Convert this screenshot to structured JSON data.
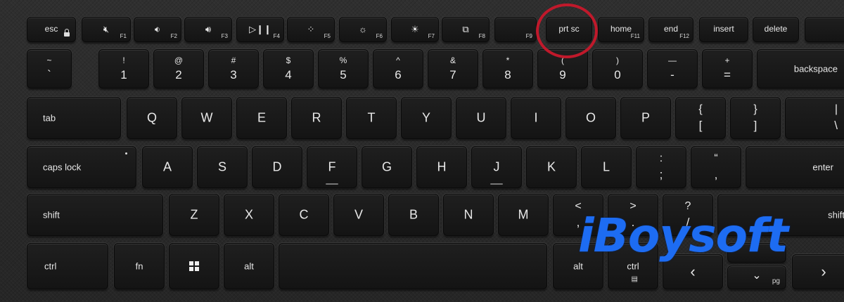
{
  "watermark": {
    "text": "iBoysoft",
    "color": "#1d6cf2"
  },
  "highlight": {
    "color": "#c0192b",
    "target": "prt sc"
  },
  "rows": {
    "function": [
      {
        "id": "esc",
        "label": "esc",
        "fn": ""
      },
      {
        "id": "f1",
        "icon": "mute-icon",
        "glyph": "🔇︎",
        "fn": "F1"
      },
      {
        "id": "f2",
        "icon": "volume-down-icon",
        "glyph": "🔉︎",
        "fn": "F2"
      },
      {
        "id": "f3",
        "icon": "volume-up-icon",
        "glyph": "🔊︎",
        "fn": "F3"
      },
      {
        "id": "f4",
        "icon": "play-pause-icon",
        "glyph": "▷❙❙",
        "fn": "F4"
      },
      {
        "id": "f5",
        "icon": "keyboard-backlight-icon",
        "glyph": "⁘",
        "fn": "F5"
      },
      {
        "id": "f6",
        "icon": "brightness-down-icon",
        "glyph": "☼",
        "fn": "F6"
      },
      {
        "id": "f7",
        "icon": "brightness-up-icon",
        "glyph": "☀",
        "fn": "F7"
      },
      {
        "id": "f8",
        "icon": "display-switch-icon",
        "glyph": "⧉",
        "fn": "F8"
      },
      {
        "id": "f9",
        "label": "",
        "fn": "F9"
      },
      {
        "id": "prtsc",
        "label": "prt sc",
        "fn": ""
      },
      {
        "id": "home",
        "label": "home",
        "fn": "F11"
      },
      {
        "id": "end",
        "label": "end",
        "fn": "F12"
      },
      {
        "id": "insert",
        "label": "insert",
        "fn": ""
      },
      {
        "id": "delete",
        "label": "delete",
        "fn": ""
      }
    ],
    "number": [
      {
        "top": "~",
        "bottom": "`"
      },
      {
        "top": "!",
        "bottom": "1"
      },
      {
        "top": "@",
        "bottom": "2"
      },
      {
        "top": "#",
        "bottom": "3"
      },
      {
        "top": "$",
        "bottom": "4"
      },
      {
        "top": "%",
        "bottom": "5"
      },
      {
        "top": "^",
        "bottom": "6"
      },
      {
        "top": "&",
        "bottom": "7"
      },
      {
        "top": "*",
        "bottom": "8"
      },
      {
        "top": "(",
        "bottom": "9"
      },
      {
        "top": ")",
        "bottom": "0"
      },
      {
        "top": "—",
        "bottom": "-"
      },
      {
        "top": "+",
        "bottom": "="
      }
    ],
    "backspace": "backspace",
    "tab": "tab",
    "qwerty": [
      "Q",
      "W",
      "E",
      "R",
      "T",
      "Y",
      "U",
      "I",
      "O",
      "P"
    ],
    "brackets": [
      {
        "top": "{",
        "bottom": "["
      },
      {
        "top": "}",
        "bottom": "]"
      },
      {
        "top": "|",
        "bottom": "\\"
      }
    ],
    "capslock": "caps lock",
    "asdf": [
      "A",
      "S",
      "D",
      "F",
      "G",
      "H",
      "J",
      "K",
      "L"
    ],
    "semi": [
      {
        "top": ":",
        "bottom": ";"
      },
      {
        "top": "“",
        "bottom": "‚"
      }
    ],
    "enter": "enter",
    "shift_left": "shift",
    "zxcv": [
      "Z",
      "X",
      "C",
      "V",
      "B",
      "N",
      "M"
    ],
    "punct": [
      {
        "top": "<",
        "bottom": ","
      },
      {
        "top": ">",
        "bottom": "."
      },
      {
        "top": "?",
        "bottom": "/"
      }
    ],
    "shift_right": "shift",
    "ctrl_left": "ctrl",
    "fn": "fn",
    "win": "windows-icon",
    "alt_left": "alt",
    "alt_right": "alt",
    "ctrl_right": "ctrl",
    "arrow_left": "‹",
    "arrow_down": "⌄",
    "pg": "pg",
    "arrow_right": "›"
  }
}
